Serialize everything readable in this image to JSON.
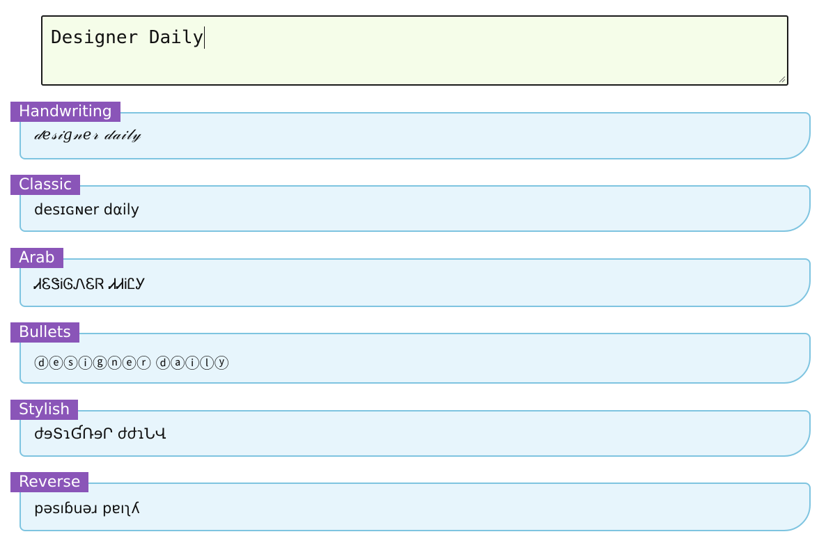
{
  "input": {
    "value": "Designer Daily"
  },
  "styles": [
    {
      "label": "Handwriting",
      "text": "𝒹𝑒𝓈𝒾𝑔𝓃𝑒𝓇 𝒹𝒶𝒾𝓁𝓎"
    },
    {
      "label": "Classic",
      "text": "desɪɢɴer dαily"
    },
    {
      "label": "Arab",
      "text": "ᏗᏋᏕᎥᎶᏁᏋᏒ ᏗᏗᎥᏝᎩ"
    },
    {
      "label": "Bullets",
      "text": "ⓓⓔⓢⓘⓖⓝⓔⓡ ⓓⓐⓘⓛⓨ"
    },
    {
      "label": "Stylish",
      "text": "ժɘՏɿƓՌɘՐ ժժɿՆՎ"
    },
    {
      "label": "Reverse",
      "text": "pəsıɓuəɹ pɐıʅʎ"
    }
  ],
  "colors": {
    "label_bg": "#8a55b8",
    "card_bg": "#e7f5fc",
    "card_border": "#7ec4e0",
    "input_bg": "#f5fde9"
  },
  "icons": {
    "resize": "resize-grip-icon"
  }
}
